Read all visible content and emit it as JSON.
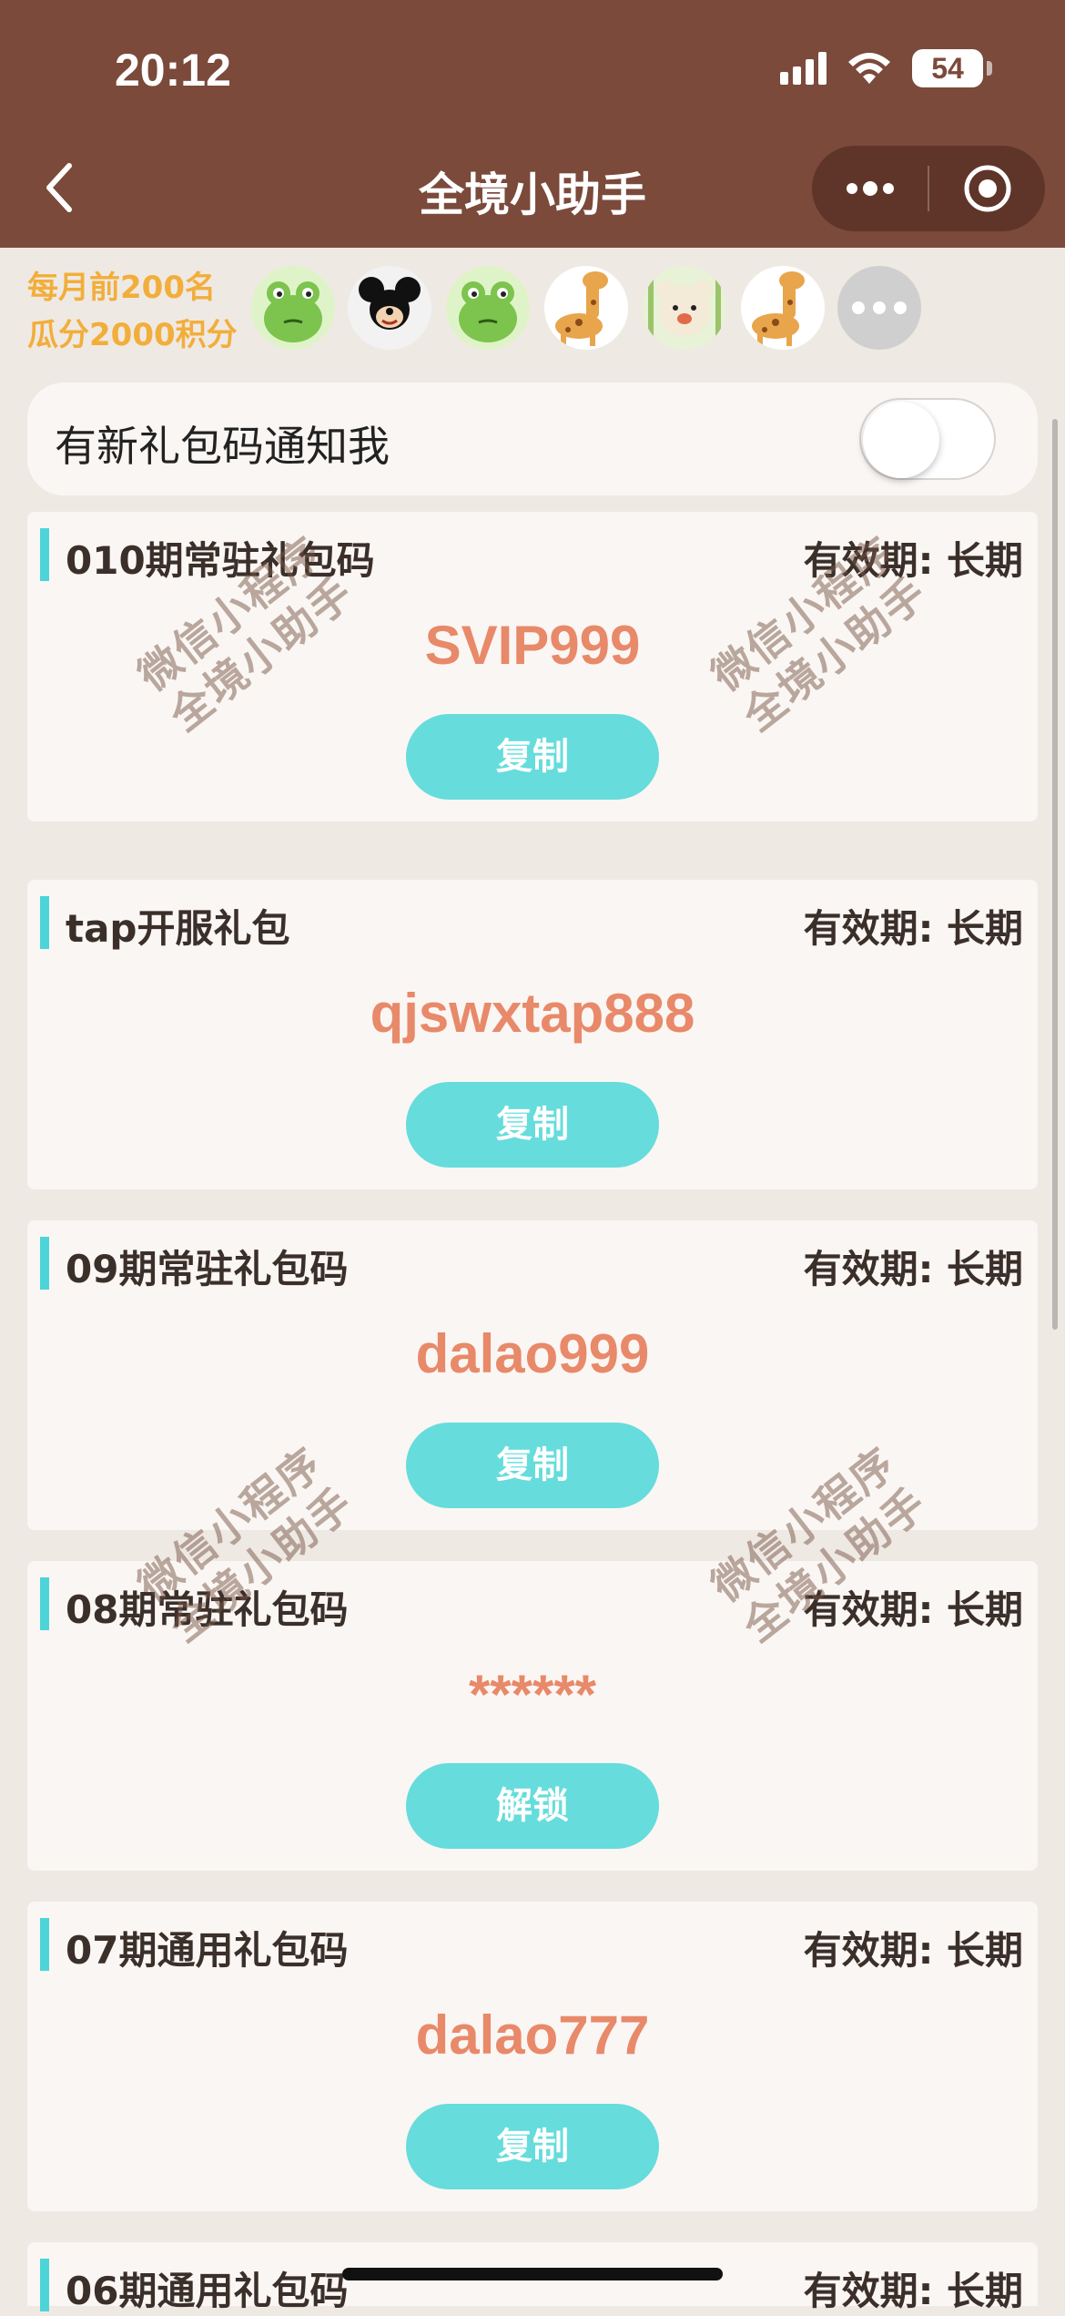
{
  "status_bar": {
    "time": "20:12",
    "battery": "54",
    "battery_fraction": 0.54
  },
  "nav": {
    "title": "全境小助手",
    "back_icon": "chevron-left-icon",
    "more_icon": "more-dots-icon",
    "close_icon": "target-icon"
  },
  "ranking": {
    "line1": "每月前200名",
    "line2": "瓜分2000积分",
    "avatars": [
      "frog",
      "mickey",
      "frog",
      "giraffe",
      "bear",
      "giraffe",
      "more"
    ]
  },
  "notify": {
    "label": "有新礼包码通知我",
    "toggle_on": false
  },
  "cards": [
    {
      "title": "010期常驻礼包码",
      "validity": "有效期: 长期",
      "code": "SVIP999",
      "button": "复制"
    },
    {
      "title": "tap开服礼包",
      "validity": "有效期: 长期",
      "code": "qjswxtap888",
      "button": "复制"
    },
    {
      "title": "09期常驻礼包码",
      "validity": "有效期: 长期",
      "code": "dalao999",
      "button": "复制"
    },
    {
      "title": "08期常驻礼包码",
      "validity": "有效期: 长期",
      "code": "******",
      "button": "解锁"
    },
    {
      "title": "07期通用礼包码",
      "validity": "有效期: 长期",
      "code": "dalao777",
      "button": "复制"
    },
    {
      "title": "06期通用礼包码",
      "validity": "有效期: 长期"
    }
  ],
  "watermark": {
    "line1": "微信小程序",
    "line2": "全境小助手"
  },
  "colors": {
    "header": "#7b4a3a",
    "accent": "#66dcdc",
    "code": "#e8896a",
    "rank_text": "#f2ae3b"
  }
}
